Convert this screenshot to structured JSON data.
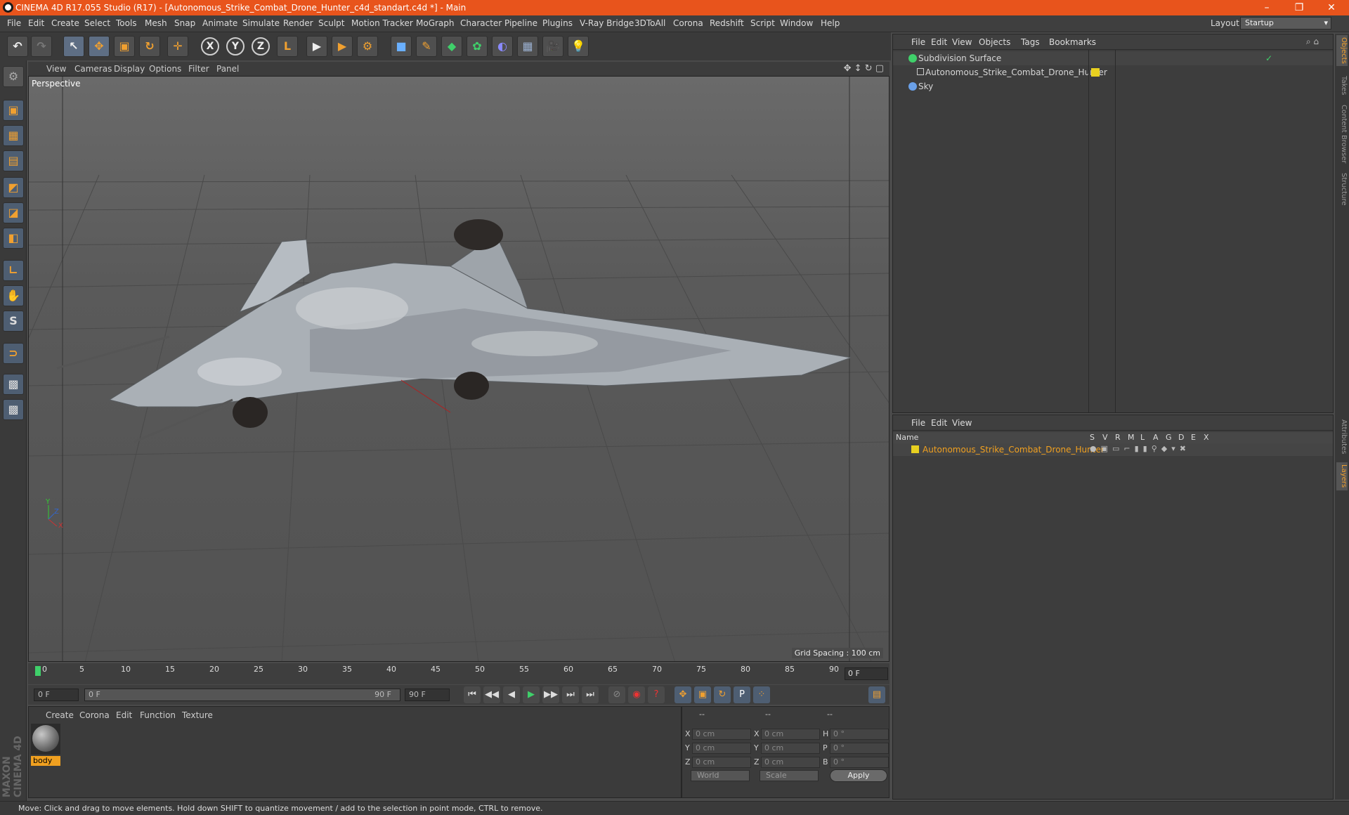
{
  "window": {
    "title": "CINEMA 4D R17.055 Studio (R17) - [Autonomous_Strike_Combat_Drone_Hunter_c4d_standart.c4d *] - Main",
    "minimize": "–",
    "restore": "❐",
    "close": "✕"
  },
  "menubar": {
    "items": [
      "File",
      "Edit",
      "Create",
      "Select",
      "Tools",
      "Mesh",
      "Snap",
      "Animate",
      "Simulate",
      "Render",
      "Sculpt",
      "Motion Tracker",
      "MoGraph",
      "Character",
      "Pipeline",
      "Plugins",
      "V-Ray Bridge",
      "3DToAll",
      "Corona",
      "Redshift",
      "Script",
      "Window",
      "Help"
    ],
    "layout_label": "Layout:",
    "layout_value": "Startup"
  },
  "toolbar": {
    "undo": "↶",
    "redo": "↷",
    "select": "↖",
    "move": "✥",
    "scale": "▣",
    "rotate": "↻",
    "transform": "✛",
    "axis_x": "X",
    "axis_y": "Y",
    "axis_z": "Z",
    "coord": "L",
    "render_view": "▶",
    "render_picture": "▶",
    "render_settings": "⚙",
    "cube": "■",
    "pen": "✎",
    "subdiv": "◆",
    "cloner": "✿",
    "deformer": "◐",
    "floor": "▦",
    "camera": "🎥",
    "light": "💡"
  },
  "left_tools": [
    "▣",
    "▦",
    "▤",
    "◩",
    "◪",
    "◧",
    "∟",
    "✋",
    "S",
    "⊃",
    "▩",
    "▩"
  ],
  "viewport": {
    "menu": [
      "View",
      "Cameras",
      "Display",
      "Options",
      "Filter",
      "Panel"
    ],
    "label": "Perspective",
    "grid_spacing": "Grid Spacing : 100 cm",
    "axis_y": "Y",
    "axis_x": "X",
    "axis_z": "Z"
  },
  "timeline": {
    "ticks": [
      "0",
      "5",
      "10",
      "15",
      "20",
      "25",
      "30",
      "35",
      "40",
      "45",
      "50",
      "55",
      "60",
      "65",
      "70",
      "75",
      "80",
      "85",
      "90"
    ],
    "current_frame": "0 F"
  },
  "playback": {
    "start": "0 F",
    "range_start": "0 F",
    "range_end": "90 F",
    "end": "90 F",
    "buttons": [
      "⏮",
      "◀◀",
      "◀",
      "▶",
      "▶▶",
      "⏭",
      "⏭"
    ]
  },
  "material": {
    "menu": [
      "Create",
      "Corona",
      "Edit",
      "Function",
      "Texture"
    ],
    "name": "body"
  },
  "coords": {
    "header": [
      "--",
      "--",
      "--"
    ],
    "rows": [
      {
        "a": "X",
        "av": "0 cm",
        "b": "X",
        "bv": "0 cm",
        "c": "H",
        "cv": "0 °"
      },
      {
        "a": "Y",
        "av": "0 cm",
        "b": "Y",
        "bv": "0 cm",
        "c": "P",
        "cv": "0 °"
      },
      {
        "a": "Z",
        "av": "0 cm",
        "b": "Z",
        "bv": "0 cm",
        "c": "B",
        "cv": "0 °"
      }
    ],
    "space": "World",
    "mode": "Scale",
    "apply": "Apply"
  },
  "objects": {
    "menu": [
      "File",
      "Edit",
      "View",
      "Objects",
      "Tags",
      "Bookmarks"
    ],
    "items": [
      {
        "name": "Subdivision Surface",
        "color": "#3fd06a"
      },
      {
        "name": "Autonomous_Strike_Combat_Drone_Hunter",
        "color": "#cfcfcf"
      },
      {
        "name": "Sky",
        "color": "#6aa0e8"
      }
    ]
  },
  "layers": {
    "menu": [
      "File",
      "Edit",
      "View"
    ],
    "header_name": "Name",
    "columns": [
      "S",
      "V",
      "R",
      "M",
      "L",
      "A",
      "G",
      "D",
      "E",
      "X"
    ],
    "row": {
      "name": "Autonomous_Strike_Combat_Drone_Hunter",
      "color": "#e8d020"
    }
  },
  "side_tabs": [
    "Objects",
    "Takes",
    "Content Browser",
    "Structure",
    "Attributes",
    "Layers"
  ],
  "maxon": "MAXON CINEMA 4D",
  "status": "Move: Click and drag to move elements. Hold down SHIFT to quantize movement / add to the selection in point mode, CTRL to remove."
}
